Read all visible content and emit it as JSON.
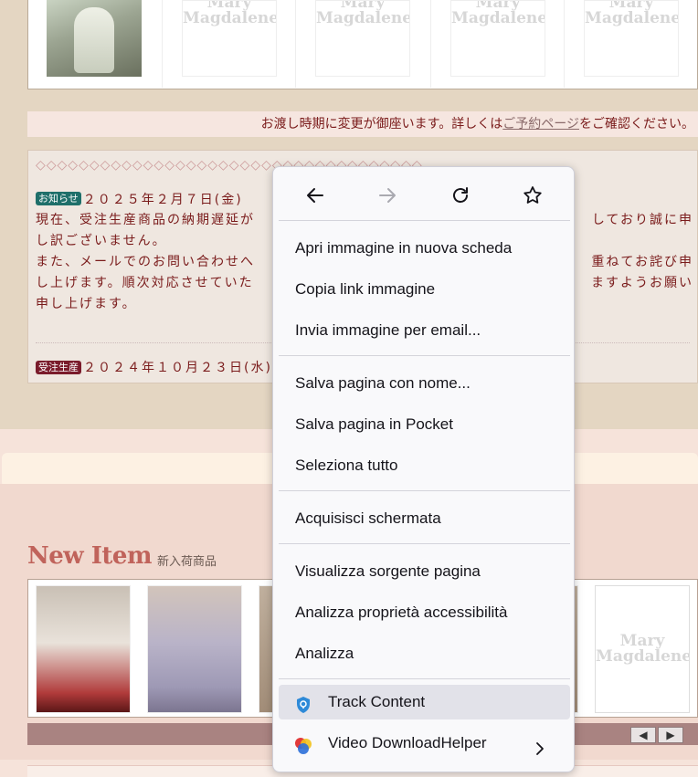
{
  "placeholder_logo": [
    "Mary",
    "Magdalene"
  ],
  "notice": {
    "before": "お渡し時期に変更が御座います。詳しくは",
    "link": "ご予約ページ",
    "after": "をご確認ください。"
  },
  "news": {
    "diamonds": "◇◇◇◇◇◇◇◇◇◇◇◇◇◇◇◇◇◇◇◇◇◇◇◇◇◇◇◇◇◇◇◇◇◇◇◇",
    "items": [
      {
        "tag": "お知らせ",
        "date": "２０２５年２月７日(金)",
        "lines": [
          "現在、受注生産商品の納期遅延が",
          "し訳ございません。",
          "また、メールでのお問い合わせへ",
          "し上げます。順次対応させていた",
          "申し上げます。"
        ],
        "lines_right": [
          "しており誠に申",
          "",
          "重ねてお詫び申",
          "ますようお願い",
          ""
        ]
      },
      {
        "tag": "受注生産",
        "date": "２０２４年１０月２３日(水)"
      }
    ]
  },
  "new_item": {
    "title": "New Item",
    "subtitle": "新入荷商品"
  },
  "carousel": {
    "prev": "◀",
    "next": "▶"
  },
  "context_menu": {
    "nav": [
      "back-icon",
      "forward-icon",
      "reload-icon",
      "bookmark-star-icon"
    ],
    "items": [
      {
        "label": "Apri immagine in nuova scheda"
      },
      {
        "label": "Copia link immagine"
      },
      {
        "label": "Invia immagine per email..."
      },
      {
        "label": "Salva pagina con nome..."
      },
      {
        "label": "Salva pagina in Pocket"
      },
      {
        "label": "Seleziona tutto"
      },
      {
        "label": "Acquisisci schermata"
      },
      {
        "label": "Visualizza sorgente pagina"
      },
      {
        "label": "Analizza proprietà accessibilità"
      },
      {
        "label": "Analizza"
      },
      {
        "label": "Track Content"
      },
      {
        "label": "Video DownloadHelper"
      }
    ]
  },
  "colors": {
    "text_maroon": "#7a1b1b",
    "menu_bg": "#f9f9fb",
    "menu_highlight": "#e2e2e9",
    "teal_tag": "#1f6f6a"
  }
}
